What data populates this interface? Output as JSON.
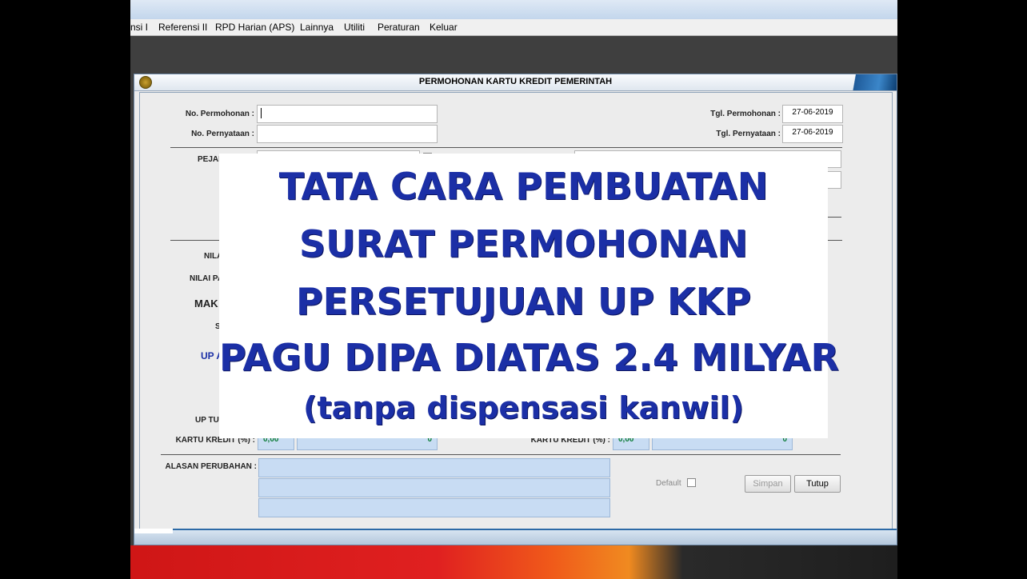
{
  "menu": [
    "nsi I",
    "Referensi II",
    "RPD Harian (APS)",
    "Lainnya",
    "Utiliti",
    "Peraturan",
    "Keluar"
  ],
  "dialog": {
    "title": "PERMOHONAN KARTU KREDIT PEMERINTAH",
    "no_permohonan_label": "No. Permohonan :",
    "no_permohonan_value": "",
    "no_pernyataan_label": "No. Pernyataan :",
    "no_pernyataan_value": "",
    "tgl_permohonan_label": "Tgl. Permohonan :",
    "tgl_permohonan_value": "27-06-2019",
    "tgl_pernyataan_label": "Tgl. Pernyataan :",
    "tgl_pernyataan_value": "27-06-2019",
    "pejabat_label_partial": "PEJAB",
    "nilai_label_partial": "NILA",
    "nilai_pagu_label_partial": "NILAI PA",
    "mak_label_partial": "MAK",
    "s_label_partial": "S",
    "up_label_partial": "UP A",
    "up_tunai_label_partial": "UP TU",
    "kartu_kredit_left_label": "KARTU KREDIT (%) :",
    "kartu_kredit_left_pct": "0,00",
    "kartu_kredit_left_amount": "0",
    "kartu_kredit_right_label": "KARTU KREDIT (%) :",
    "kartu_kredit_right_pct": "0,00",
    "kartu_kredit_right_amount": "0",
    "alasan_label": "ALASAN PERUBAHAN :",
    "default_label": "Default",
    "simpan_button": "Simpan",
    "tutup_button": "Tutup"
  },
  "overlay": {
    "line1": "TATA CARA PEMBUATAN",
    "line2": "SURAT PERMOHONAN",
    "line3": "PERSETUJUAN UP KKP",
    "line4": "PAGU DIPA DIATAS 2.4 MILYAR",
    "line5": "(tanpa dispensasi kanwil)"
  }
}
